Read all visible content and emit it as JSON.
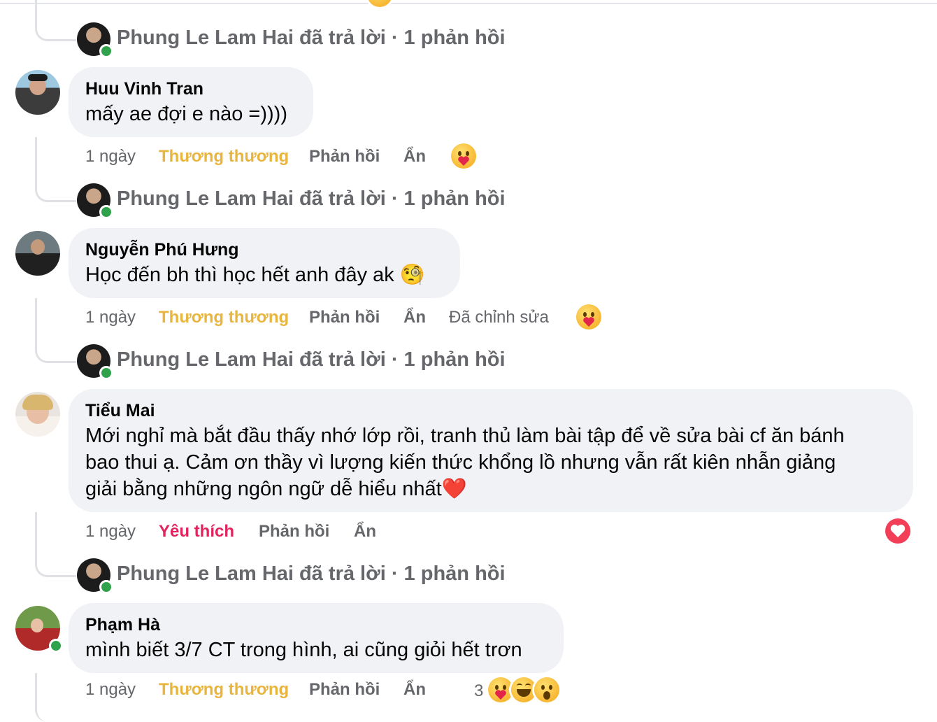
{
  "reply_summaries": [
    {
      "text": "Phung Le Lam Hai đã trả lời · 1 phản hồi"
    },
    {
      "text": "Phung Le Lam Hai đã trả lời · 1 phản hồi"
    },
    {
      "text": "Phung Le Lam Hai đã trả lời · 1 phản hồi"
    },
    {
      "text": "Phung Le Lam Hai đã trả lời · 1 phản hồi"
    }
  ],
  "comments": [
    {
      "author": "Huu Vinh Tran",
      "text": "mấy ae đợi e nào =))))",
      "time": "1 ngày",
      "reaction_label": "Thương thương",
      "reply_label": "Phản hồi",
      "hide_label": "Ẩn",
      "reaction_icons": [
        "care-emoji-icon"
      ]
    },
    {
      "author": "Nguyễn Phú Hưng",
      "text": "Học đến bh thì học hết anh đây ak 🧐",
      "time": "1 ngày",
      "reaction_label": "Thương thương",
      "reply_label": "Phản hồi",
      "hide_label": "Ẩn",
      "edited_label": "Đã chỉnh sửa",
      "reaction_icons": [
        "care-emoji-icon"
      ]
    },
    {
      "author": "Tiểu Mai",
      "text_lines": [
        "Mới nghỉ mà bắt đầu thấy nhớ lớp rồi, tranh thủ làm bài tập để về sửa bài cf ăn bánh",
        "bao thui ạ. Cảm ơn thầy vì lượng kiến thức khổng lồ nhưng vẫn rất kiên nhẫn giảng",
        "giải bằng những ngôn ngữ dễ hiểu nhất❤️"
      ],
      "time": "1 ngày",
      "reaction_label": "Yêu thích",
      "reply_label": "Phản hồi",
      "hide_label": "Ẩn",
      "reaction_icons": [
        "love-heart-icon"
      ]
    },
    {
      "author": "Phạm Hà",
      "text": "mình biết 3/7 CT trong hình, ai cũng giỏi hết trơn",
      "time": "1 ngày",
      "reaction_label": "Thương thương",
      "reply_label": "Phản hồi",
      "hide_label": "Ẩn",
      "reaction_count": "3",
      "reaction_icons": [
        "care-emoji-icon",
        "laughing-emoji-icon",
        "wow-emoji-icon"
      ]
    }
  ],
  "colors": {
    "love_reaction": "#e8b53f",
    "heart_reaction": "#e0245e",
    "bubble": "#f0f2f5",
    "online": "#31a24c"
  }
}
